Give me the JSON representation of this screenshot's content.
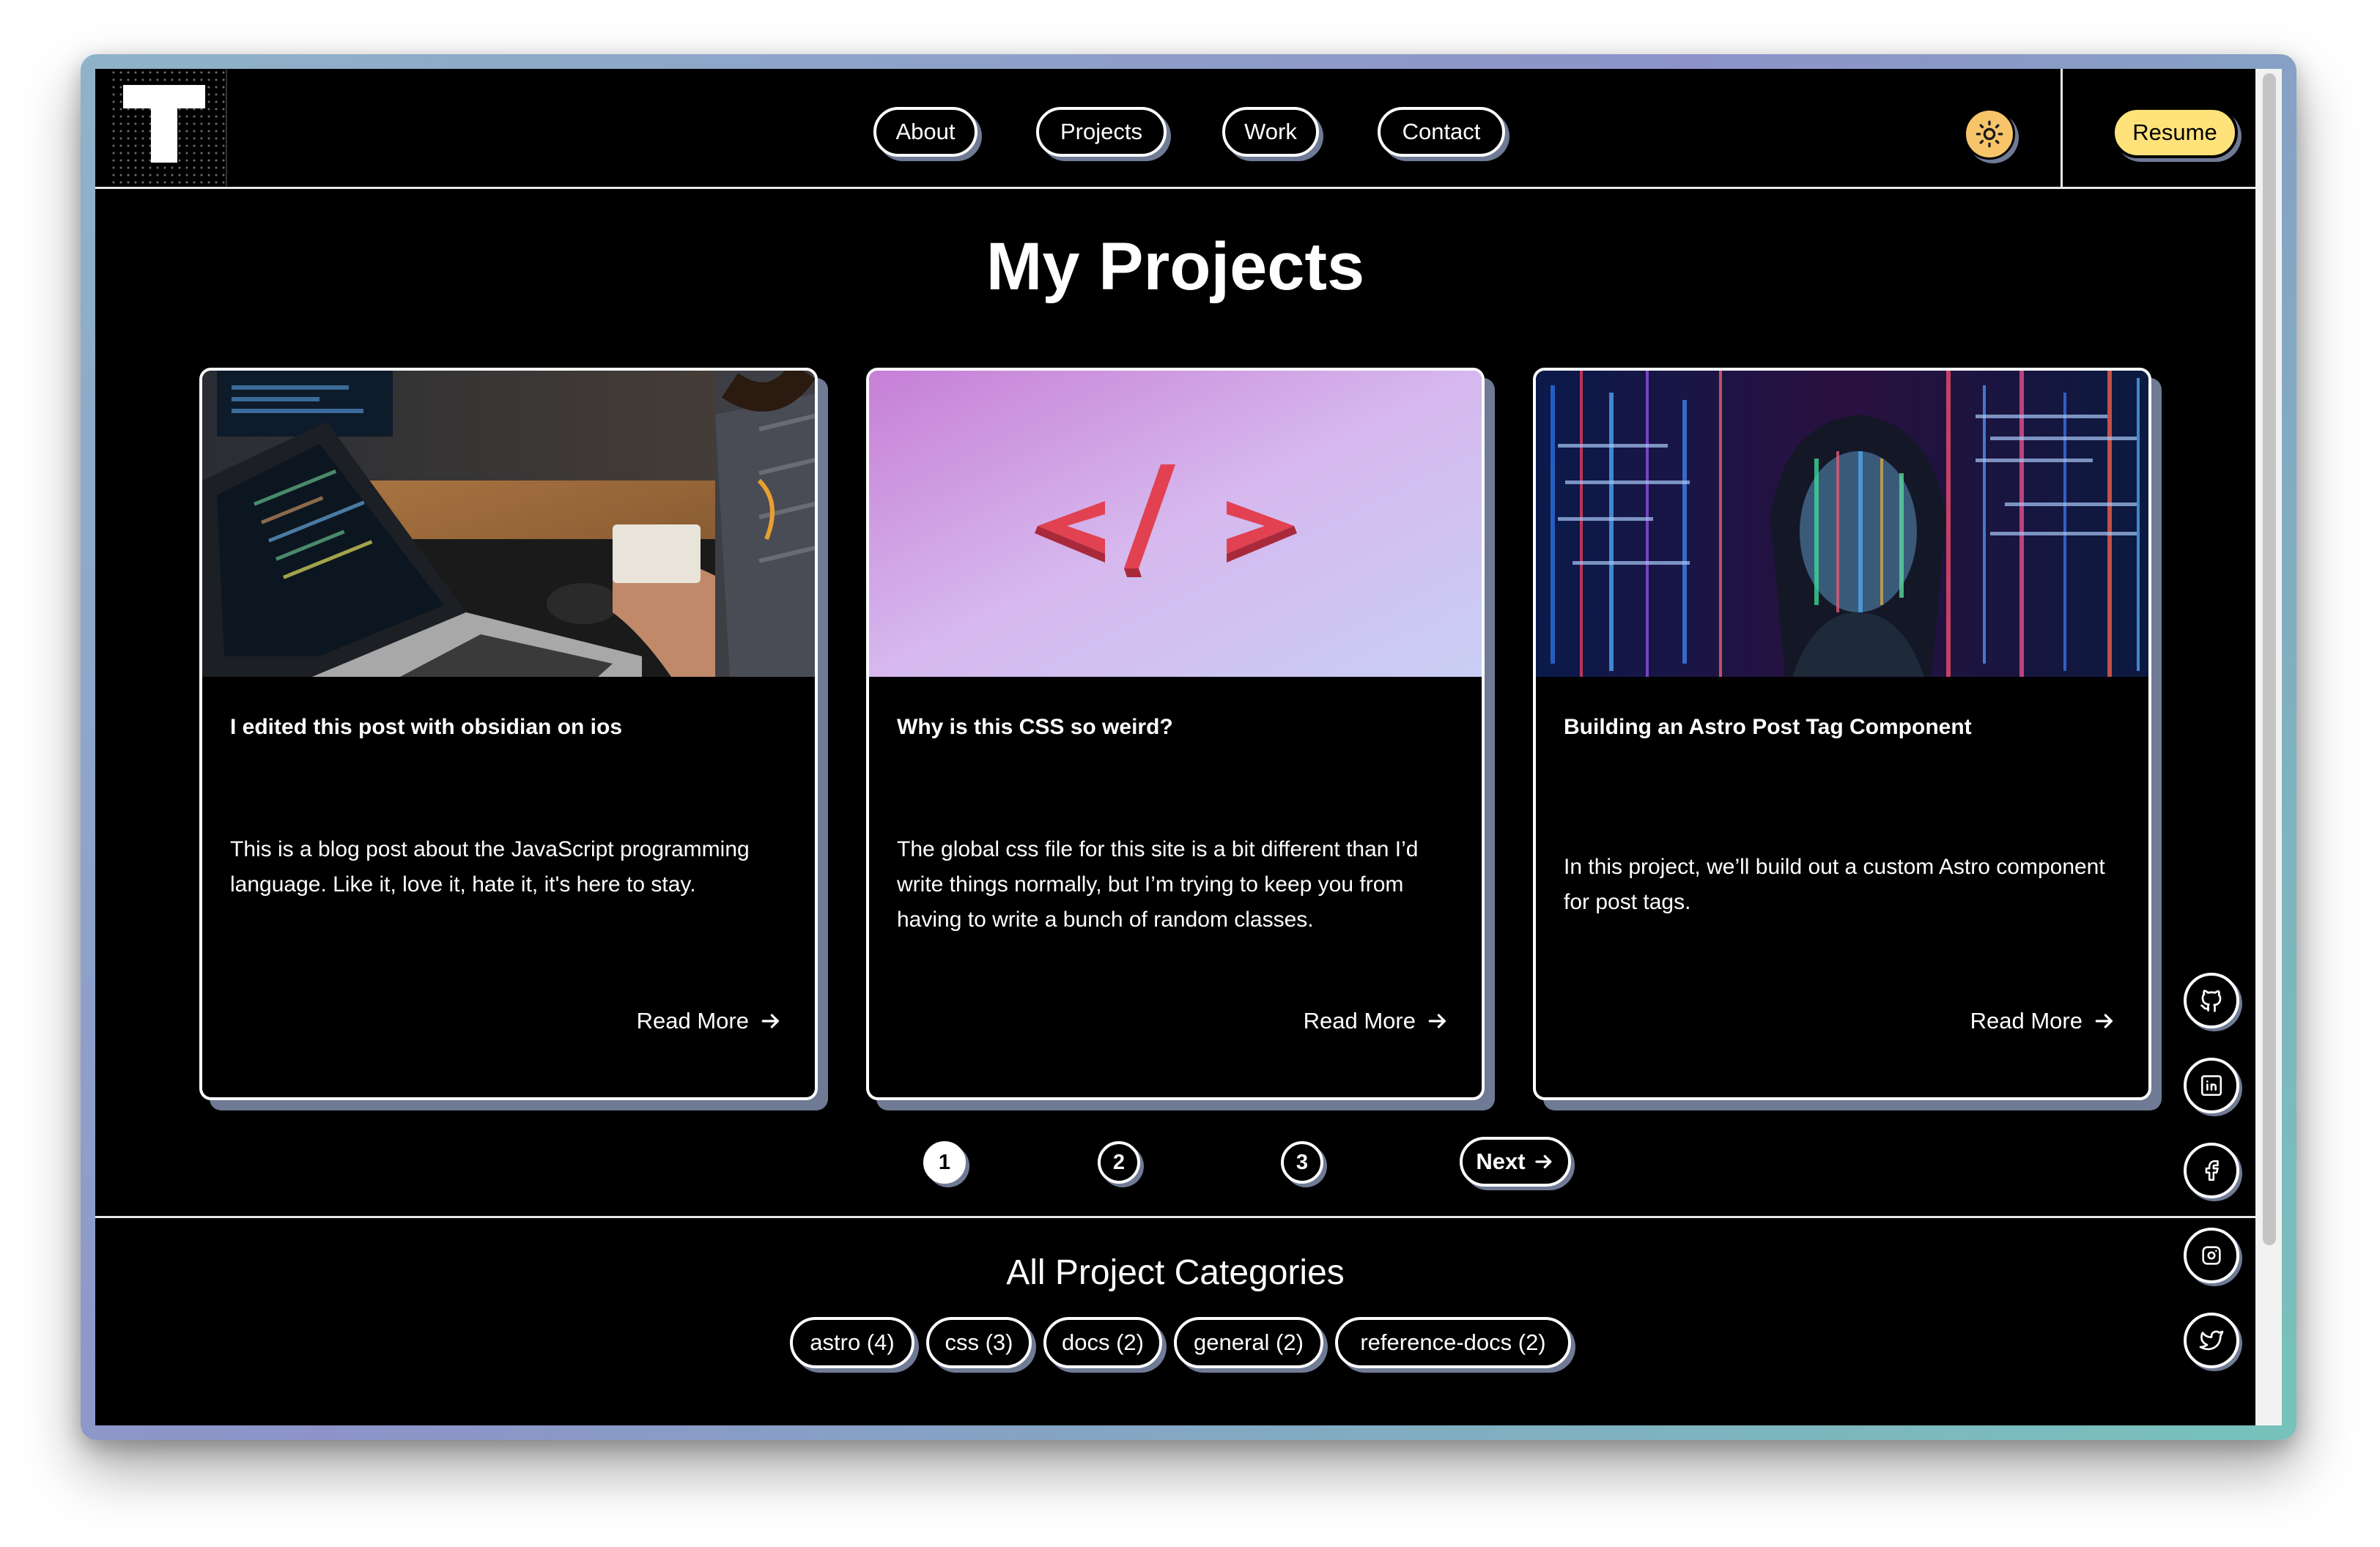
{
  "nav": {
    "items": [
      {
        "label": "About"
      },
      {
        "label": "Projects"
      },
      {
        "label": "Work"
      },
      {
        "label": "Contact"
      }
    ],
    "resume_label": "Resume",
    "theme_toggle_icon": "sun-icon"
  },
  "main": {
    "title": "My Projects",
    "cards": [
      {
        "title": "I edited this post with obsidian on ios",
        "description": "This is a blog post about the JavaScript programming language. Like it, love it, hate it, it's here to stay.",
        "read_more": "Read More",
        "image": "laptop-coding-photo"
      },
      {
        "title": "Why is this CSS so weird?",
        "description": "The global css file for this site is a bit different than I’d write things normally, but I’m trying to keep you from having to write a bunch of random classes.",
        "read_more": "Read More",
        "image": "code-brackets-photo"
      },
      {
        "title": "Building an Astro Post Tag Component",
        "description": "In this project, we’ll build out a custom Astro component for post tags.",
        "read_more": "Read More",
        "image": "woman-projected-code-photo"
      }
    ],
    "pagination": {
      "pages": [
        "1",
        "2",
        "3"
      ],
      "active_page": "1",
      "next_label": "Next"
    }
  },
  "categories": {
    "title": "All Project Categories",
    "tags": [
      {
        "label": "astro (4)"
      },
      {
        "label": "css (3)"
      },
      {
        "label": "docs (2)"
      },
      {
        "label": "general (2)"
      },
      {
        "label": "reference-docs (2)"
      }
    ]
  },
  "social": {
    "icons": [
      "github-icon",
      "linkedin-icon",
      "facebook-icon",
      "instagram-icon",
      "twitter-icon"
    ]
  },
  "colors": {
    "background": "#000000",
    "text": "#ffffff",
    "shadow": "#6f7a95",
    "resume_bg": "#ffe27a",
    "theme_toggle_bg": "#f7c46a"
  }
}
